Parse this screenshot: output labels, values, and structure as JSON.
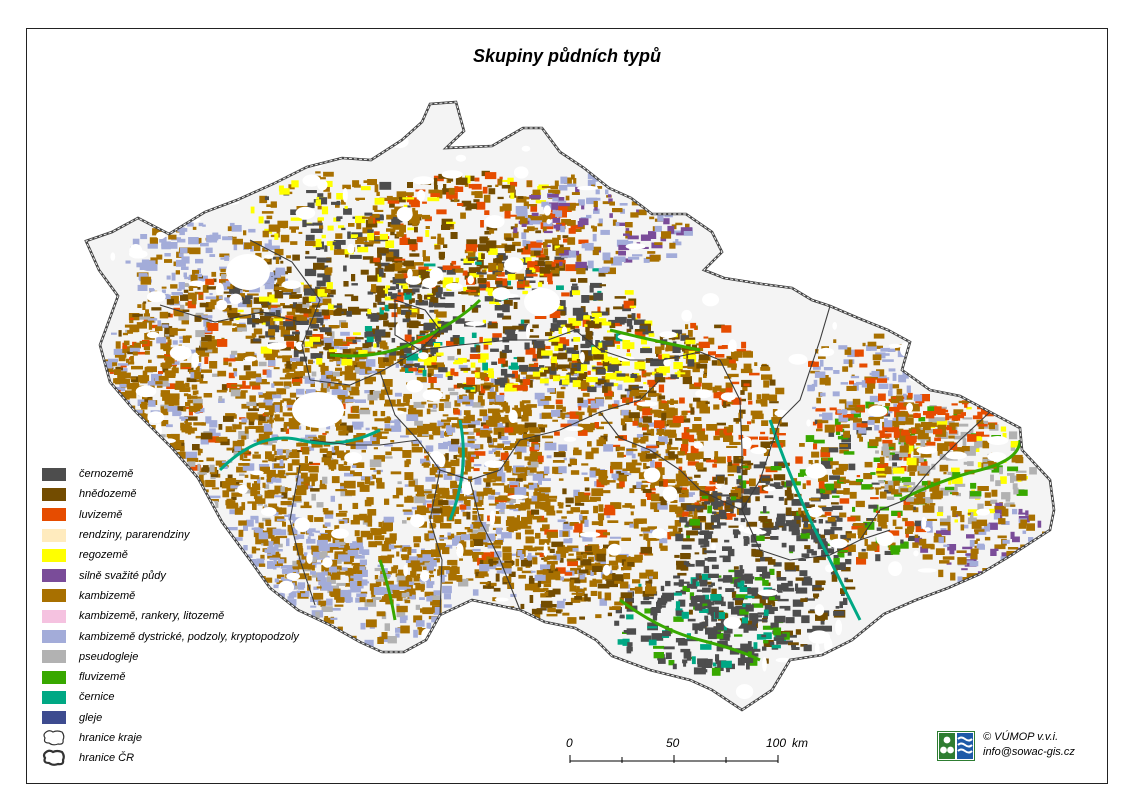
{
  "title": "Skupiny půdních typů",
  "legend": [
    {
      "label": "černozemě",
      "color": "#4d4d4d",
      "type": "fill"
    },
    {
      "label": "hnědozemě",
      "color": "#734c00",
      "type": "fill"
    },
    {
      "label": "luvizemě",
      "color": "#e64c00",
      "type": "fill"
    },
    {
      "label": "rendziny, pararendziny",
      "color": "#ffebbe",
      "type": "fill"
    },
    {
      "label": "regozemě",
      "color": "#ffff00",
      "type": "fill"
    },
    {
      "label": "silně svažité půdy",
      "color": "#7a4c99",
      "type": "fill"
    },
    {
      "label": "kambizemě",
      "color": "#a87000",
      "type": "fill"
    },
    {
      "label": "kambizemě, rankery, litozemě",
      "color": "#f5c2e0",
      "type": "fill"
    },
    {
      "label": "kambizemě dystrické, podzoly, kryptopodzoly",
      "color": "#a3acd9",
      "type": "fill"
    },
    {
      "label": "pseudogleje",
      "color": "#b2b2b2",
      "type": "fill"
    },
    {
      "label": "fluvizemě",
      "color": "#38a800",
      "type": "fill"
    },
    {
      "label": "černice",
      "color": "#00a884",
      "type": "fill"
    },
    {
      "label": "gleje",
      "color": "#3d4b8f",
      "type": "fill"
    },
    {
      "label": "hranice kraje",
      "type": "border"
    },
    {
      "label": "hranice ČR",
      "type": "border-bold"
    }
  ],
  "scale": {
    "labels": [
      "0",
      "50",
      "100"
    ],
    "unit": "km"
  },
  "credit": {
    "line1": "© VÚMOP v.v.i.",
    "line2": "info@sowac-gis.cz"
  }
}
